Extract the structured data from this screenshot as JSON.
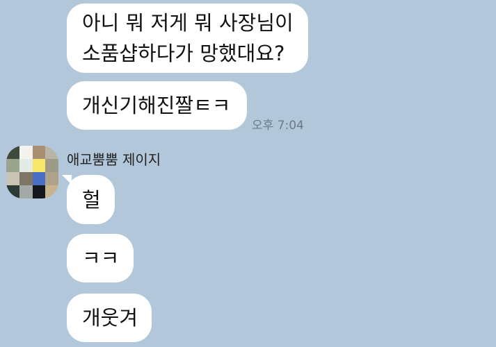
{
  "messages_outgoing": [
    {
      "text": "아니 뭐 저게 뭐 사장님이\n소품샵하다가 망했대요?"
    },
    {
      "text": "개신기해진짤ㅌㅋ"
    }
  ],
  "outgoing_time": "오후 7:04",
  "incoming": {
    "sender_name": "애교뿜뿜 제이지",
    "messages": [
      {
        "text": "헐"
      },
      {
        "text": "ㅋㅋ"
      },
      {
        "text": "개웃겨"
      }
    ]
  },
  "colors": {
    "background": "#b2c7da",
    "bubble": "#ffffff",
    "timestamp": "#6b7a88"
  },
  "avatar_pixels": [
    "#3f4a3c",
    "#f2f2ee",
    "#a98f72",
    "#b9b4a8",
    "#9aa38d",
    "#e4ebe6",
    "#f6e76a",
    "#9e9a88",
    "#c9c3b6",
    "#7f7566",
    "#4a6fc5",
    "#b0a18a",
    "#2c3a36",
    "#a3aaa5",
    "#14181c",
    "#c8b48c"
  ]
}
